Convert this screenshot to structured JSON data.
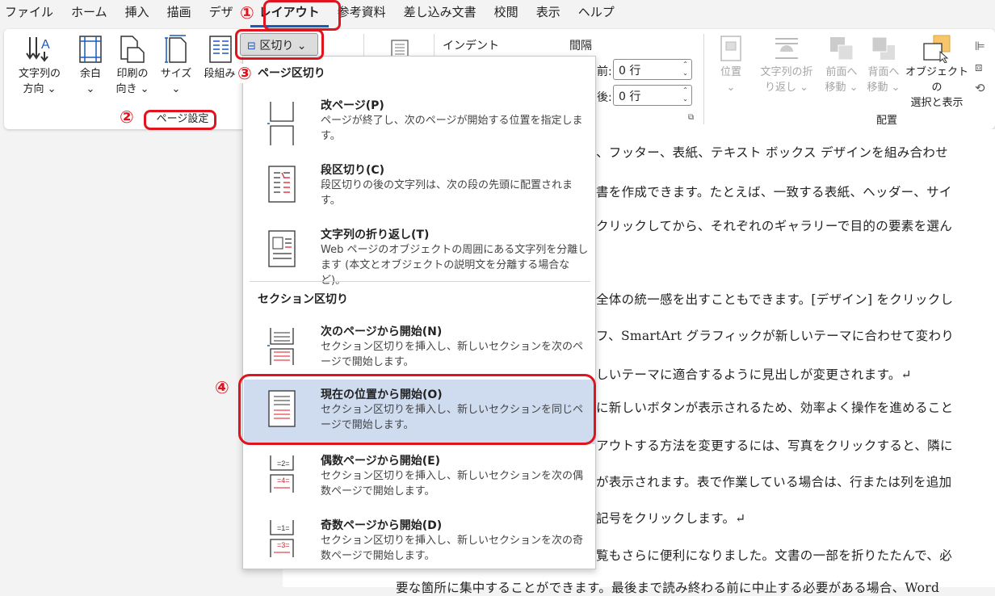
{
  "menubar": {
    "tabs": [
      "ファイル",
      "ホーム",
      "挿入",
      "描画",
      "デザ",
      "レイアウト",
      "参考資料",
      "差し込み文書",
      "校閲",
      "表示",
      "ヘルプ"
    ],
    "active": "レイアウト"
  },
  "ribbon": {
    "text_direction": "文字列の\n方向 ⌄",
    "margins": "余白\n⌄",
    "orientation": "印刷の\n向き ⌄",
    "size": "サイズ\n⌄",
    "columns": "段組み",
    "page_setup_label": "ページ設定",
    "breaks_button": "区切り ⌄",
    "indent_label": "インデント",
    "spacing_label": "間隔",
    "spacing_before_label": "前:",
    "spacing_before_value": "0 行",
    "spacing_after_label": "後:",
    "spacing_after_value": "0 行",
    "position": "位置\n⌄",
    "wrap_text": "文字列の折\nり返し ⌄",
    "bring_forward": "前面へ\n移動 ⌄",
    "send_backward": "背面へ\n移動 ⌄",
    "selection_pane": "オブジェクトの\n選択と表示",
    "arrange_label": "配置"
  },
  "dropdown": {
    "page_breaks_header": "ページ区切り",
    "section_breaks_header": "セクション区切り",
    "items": [
      {
        "title": "改ページ(P)",
        "desc": "ページが終了し、次のページが開始する位置を指定します。"
      },
      {
        "title": "段区切り(C)",
        "desc": "段区切りの後の文字列は、次の段の先頭に配置されます。"
      },
      {
        "title": "文字列の折り返し(T)",
        "desc": "Web ページのオブジェクトの周囲にある文字列を分離します (本文とオブジェクトの説明文を分離する場合など)。"
      },
      {
        "title": "次のページから開始(N)",
        "desc": "セクション区切りを挿入し、新しいセクションを次のページで開始します。"
      },
      {
        "title": "現在の位置から開始(O)",
        "desc": "セクション区切りを挿入し、新しいセクションを同じページで開始します。"
      },
      {
        "title": "偶数ページから開始(E)",
        "desc": "セクション区切りを挿入し、新しいセクションを次の偶数ページで開始します。"
      },
      {
        "title": "奇数ページから開始(D)",
        "desc": "セクション区切りを挿入し、新しいセクションを次の奇数ページで開始します。"
      }
    ],
    "highlighted_index": 4
  },
  "document": {
    "lines": [
      "、フッター、表紙、テキスト ボックス デザインを組み合わせ",
      "書を作成できます。たとえば、一致する表紙、ヘッダー、サイ",
      "クリックしてから、それぞれのギャラリーで目的の要素を選ん",
      "",
      "全体の統一感を出すこともできます。[デザイン] をクリックし",
      "フ、SmartArt グラフィックが新しいテーマに合わせて変わり",
      "しいテーマに適合するように見出しが変更されます。↵",
      "に新しいボタンが表示されるため、効率よく操作を進めること",
      "アウトする方法を変更するには、写真をクリックすると、隣に",
      "が表示されます。表で作業している場合は、行または列を追加",
      "記号をクリックします。↵",
      "覧もさらに便利になりました。文書の一部を折りたたんで、必",
      "要な箇所に集中することができます。最後まで読み終わる前に中止する必要がある場合、Word"
    ]
  },
  "annotations": {
    "n1": "①",
    "n2": "②",
    "n3": "③",
    "n4": "④"
  },
  "colors": {
    "accent_red": "#e0141e",
    "highlight": "#cfdcef",
    "word_blue": "#185abd"
  }
}
